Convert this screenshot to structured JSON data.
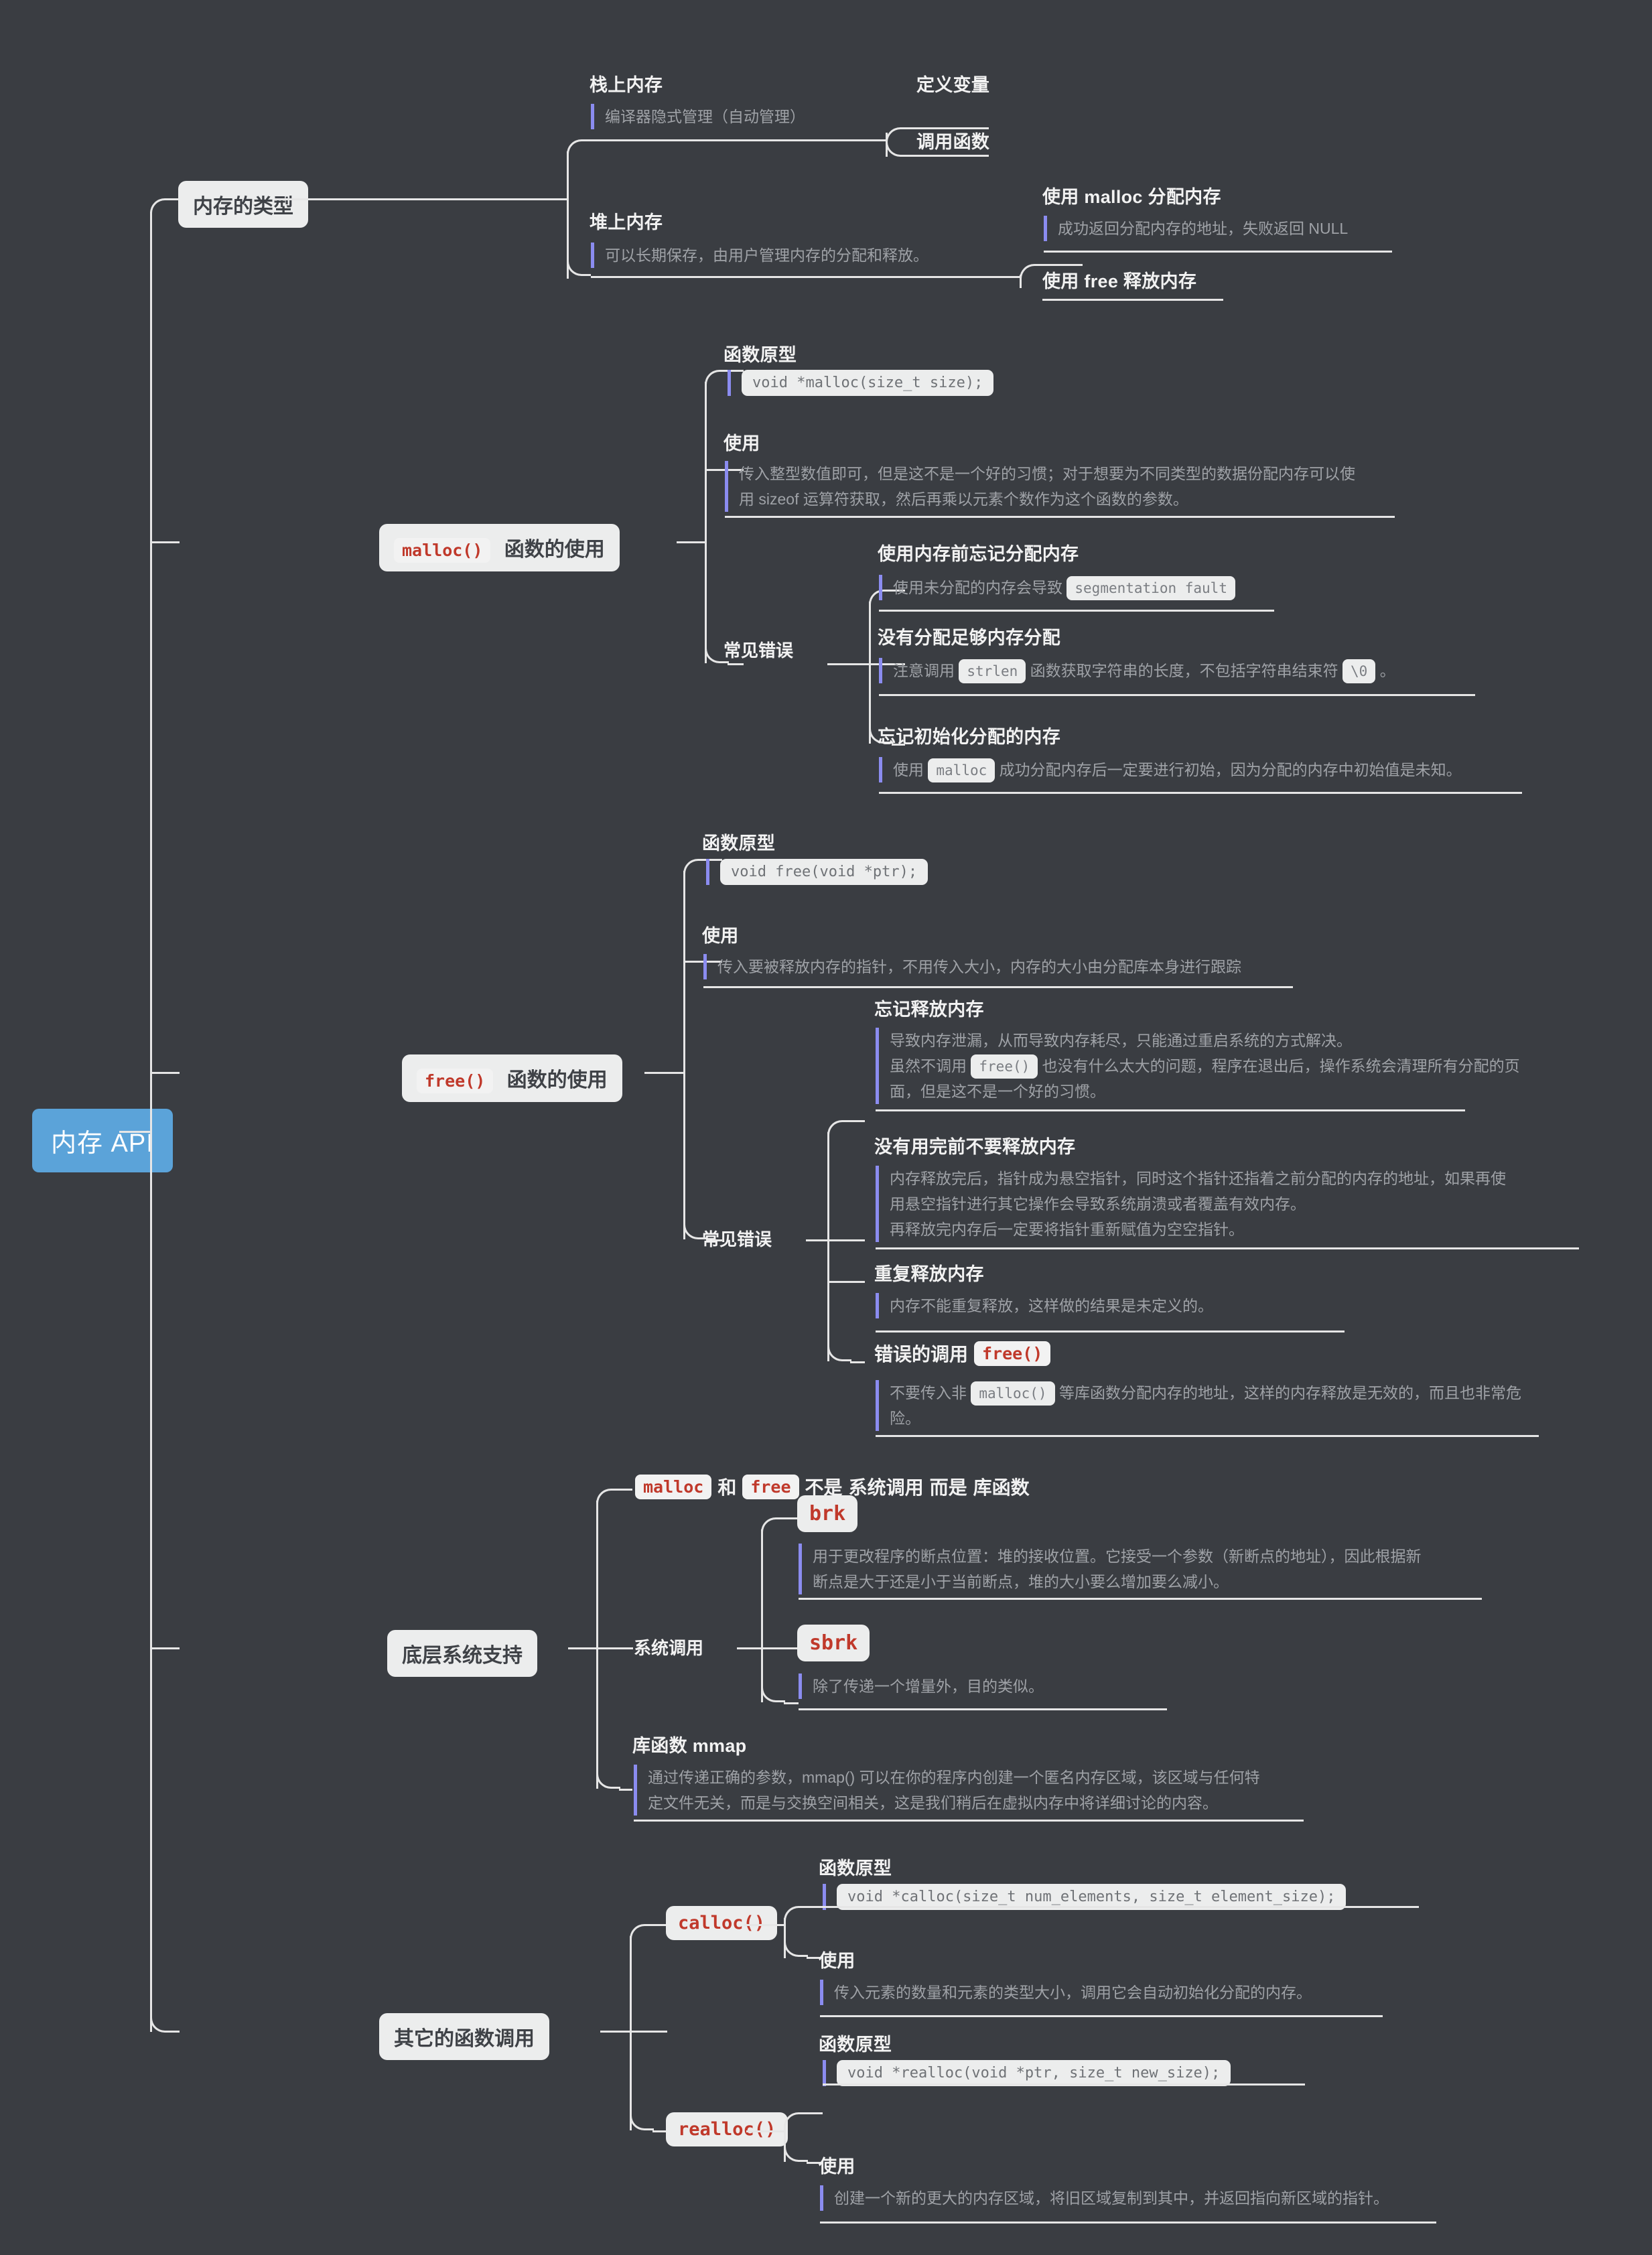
{
  "root": {
    "label": "内存 API",
    "color": "#5ba3d9"
  },
  "branches": {
    "memory_types": {
      "label": "内存的类型",
      "children": [
        {
          "title": "栈上内存",
          "note": "编译器隐式管理（自动管理）",
          "leaves": [
            "定义变量",
            "调用函数"
          ]
        },
        {
          "title": "堆上内存",
          "note": "可以长期保存，由用户管理内存的分配和释放。",
          "leaves_detail": [
            {
              "title": "使用 malloc 分配内存",
              "note": "成功返回分配内存的地址，失败返回 NULL"
            },
            {
              "title": "使用 free 释放内存",
              "note": ""
            }
          ]
        }
      ]
    },
    "malloc": {
      "chip_code": "malloc()",
      "chip_text": "函数的使用",
      "prototype_title": "函数原型",
      "prototype_code": "void *malloc(size_t size);",
      "usage_title": "使用",
      "usage_line1": "传入整型数值即可，但是这不是一个好的习惯；对于想要为不同类型的数据份配内存可以使",
      "usage_line2": "用 sizeof 运算符获取，然后再乘以元素个数作为这个函数的参数。",
      "errors_label": "常见错误",
      "errors": [
        {
          "title": "使用内存前忘记分配内存",
          "note_pre": "使用未分配的内存会导致",
          "note_code": "segmentation fault",
          "note_post": ""
        },
        {
          "title": "没有分配足够内存分配",
          "note_pre": "注意调用",
          "note_code": "strlen",
          "note_mid": "函数获取字符串的长度，不包括字符串结束符",
          "note_code2": "\\0",
          "note_post": "。"
        },
        {
          "title": "忘记初始化分配的内存",
          "note_pre": "使用",
          "note_code": "malloc",
          "note_post": "成功分配内存后一定要进行初始，因为分配的内存中初始值是未知。"
        }
      ]
    },
    "free": {
      "chip_code": "free()",
      "chip_text": "函数的使用",
      "prototype_title": "函数原型",
      "prototype_code": "void free(void *ptr);",
      "usage_title": "使用",
      "usage_note": "传入要被释放内存的指针，不用传入大小，内存的大小由分配库本身进行跟踪",
      "errors_label": "常见错误",
      "errors": [
        {
          "title": "忘记释放内存",
          "line1": "导致内存泄漏，从而导致内存耗尽，只能通过重启系统的方式解决。",
          "line2_pre": "虽然不调用",
          "line2_code": "free()",
          "line2_post": "也没有什么太大的问题，程序在退出后，操作系统会清理所有分配的页",
          "line3": "面，但是这不是一个好的习惯。"
        },
        {
          "title": "没有用完前不要释放内存",
          "line1": "内存释放完后，指针成为悬空指针，同时这个指针还指着之前分配的内存的地址，如果再使",
          "line2": "用悬空指针进行其它操作会导致系统崩溃或者覆盖有效内存。",
          "line3": "再释放完内存后一定要将指针重新赋值为空空指针。"
        },
        {
          "title": "重复释放内存",
          "line1": "内存不能重复释放，这样做的结果是未定义的。"
        },
        {
          "title_pre": "错误的调用",
          "title_code": "free()",
          "line1_pre": "不要传入非",
          "line1_code": "malloc()",
          "line1_post": "等库函数分配内存的地址，这样的内存释放是无效的，而且也非常危",
          "line2": "险。"
        }
      ]
    },
    "system_support": {
      "label": "底层系统支持",
      "header": {
        "code1": "malloc",
        "mid": "和",
        "code2": "free",
        "tail_plain": "不是",
        "tail_bold1": "系统调用",
        "tail_mid": "而是",
        "tail_bold2": "库函数"
      },
      "syscall_label": "系统调用",
      "syscalls": [
        {
          "code": "brk",
          "line1": "用于更改程序的断点位置：堆的接收位置。它接受一个参数（新断点的地址），因此根据新",
          "line2": "断点是大于还是小于当前断点，堆的大小要么增加要么减小。"
        },
        {
          "code": "sbrk",
          "line1": "除了传递一个增量外，目的类似。"
        }
      ],
      "mmap": {
        "title": "库函数 mmap",
        "line1": "通过传递正确的参数，mmap() 可以在你的程序内创建一个匿名内存区域，该区域与任何特",
        "line2": "定文件无关，而是与交换空间相关，这是我们稍后在虚拟内存中将详细讨论的内容。"
      }
    },
    "other_functions": {
      "label": "其它的函数调用",
      "items": [
        {
          "code": "calloc()",
          "prototype_title": "函数原型",
          "prototype_code": "void *calloc(size_t num_elements, size_t element_size);",
          "usage_title": "使用",
          "usage_note": "传入元素的数量和元素的类型大小，调用它会自动初始化分配的内存。"
        },
        {
          "code": "realloc()",
          "prototype_title": "函数原型",
          "prototype_code": "void *realloc(void *ptr, size_t new_size);",
          "usage_title": "使用",
          "usage_note": "创建一个新的更大的内存区域，将旧区域复制到其中，并返回指向新区域的指针。"
        }
      ]
    }
  }
}
